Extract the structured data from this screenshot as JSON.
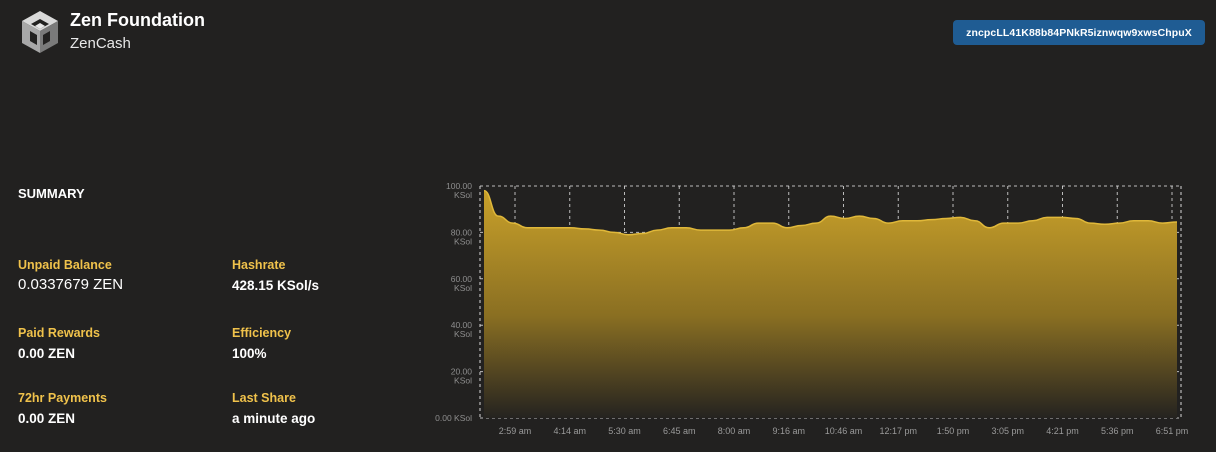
{
  "header": {
    "org_name": "Zen Foundation",
    "coin_name": "ZenCash",
    "wallet_address": "zncpcLL41K88b84PNkR5iznwqw9xwsChpuX",
    "logo_icon": "zen-cube-logo"
  },
  "summary": {
    "title": "SUMMARY",
    "unpaid_balance": {
      "label": "Unpaid Balance",
      "value": "0.0337679 ZEN"
    },
    "hashrate": {
      "label": "Hashrate",
      "value": "428.15 KSol/s"
    },
    "paid_rewards": {
      "label": "Paid Rewards",
      "value": "0.00 ZEN"
    },
    "efficiency": {
      "label": "Efficiency",
      "value": "100%"
    },
    "payments_72hr": {
      "label": "72hr Payments",
      "value": "0.00 ZEN"
    },
    "last_share": {
      "label": "Last Share",
      "value": "a minute ago"
    }
  },
  "colors": {
    "accent": "#f0c24b",
    "button": "#1f5c93",
    "area_fill_top": "#c9a12a",
    "background": "#222120"
  },
  "chart_data": {
    "type": "area",
    "title": "",
    "xlabel": "",
    "ylabel": "",
    "ylim": [
      0,
      100
    ],
    "grid": true,
    "y_ticks": [
      {
        "value": 100,
        "label": "100.00",
        "unit": "KSol"
      },
      {
        "value": 80,
        "label": "80.00",
        "unit": "KSol"
      },
      {
        "value": 60,
        "label": "60.00",
        "unit": "KSol"
      },
      {
        "value": 40,
        "label": "40.00",
        "unit": "KSol"
      },
      {
        "value": 20,
        "label": "20.00",
        "unit": "KSol"
      },
      {
        "value": 0,
        "label": "0.00 KSol",
        "unit": ""
      }
    ],
    "x_ticks": [
      "2:59 am",
      "4:14 am",
      "5:30 am",
      "6:45 am",
      "8:00 am",
      "9:16 am",
      "10:46 am",
      "12:17 pm",
      "1:50 pm",
      "3:05 pm",
      "4:21 pm",
      "5:36 pm",
      "6:51 pm"
    ],
    "series": [
      {
        "values": [
          98,
          87,
          84,
          82,
          82,
          82,
          82,
          81.5,
          81,
          80,
          79,
          79.5,
          81,
          82,
          82,
          81,
          81,
          81,
          82,
          84,
          84,
          82,
          83,
          84,
          87,
          86,
          87,
          86,
          84,
          85,
          85,
          85.5,
          86,
          86.5,
          85,
          82,
          84,
          84,
          85,
          86.5,
          86.5,
          86,
          84,
          83.5,
          84,
          85,
          85,
          84,
          84.5
        ]
      }
    ]
  }
}
